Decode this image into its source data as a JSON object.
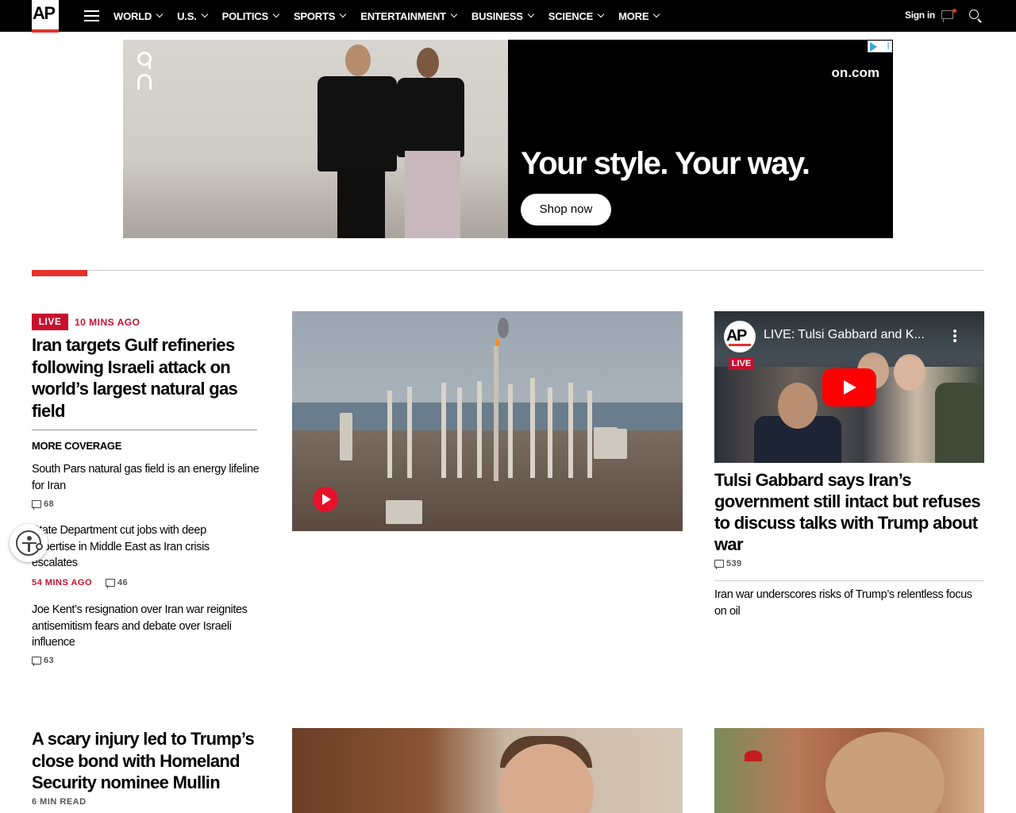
{
  "header": {
    "logo_text": "AP",
    "nav_items": [
      "WORLD",
      "U.S.",
      "POLITICS",
      "SPORTS",
      "ENTERTAINMENT",
      "BUSINESS",
      "SCIENCE",
      "MORE"
    ],
    "sign_in": "Sign in",
    "icons": [
      "menu-icon",
      "chevron-down-icon",
      "notification-icon",
      "search-icon"
    ]
  },
  "ad": {
    "domain": "on.com",
    "headline": "Your style. Your way.",
    "cta": "Shop now"
  },
  "lead": {
    "live_label": "LIVE",
    "time": "10 MINS AGO",
    "headline": "Iran targets Gulf refineries following Israeli attack on world’s largest natural gas field",
    "more_coverage": "MORE COVERAGE",
    "stories": [
      {
        "title": "South Pars natural gas field is an energy lifeline for Iran",
        "comments": "68"
      },
      {
        "title": "State Department cut jobs with deep expertise in Middle East as Iran crisis escalates",
        "time": "54 MINS AGO",
        "comments": "46"
      },
      {
        "title": "Joe Kent’s resignation over Iran war reignites antisemitism fears and debate over Israeli influence",
        "comments": "63"
      }
    ]
  },
  "video": {
    "logo_text": "AP",
    "live_label": "LIVE",
    "title": "LIVE: Tulsi Gabbard and K..."
  },
  "right": {
    "headline": "Tulsi Gabbard says Iran’s government still intact but refuses to discuss talks with Trump about war",
    "comments": "539",
    "sub_story": "Iran war underscores risks of Trump’s relentless focus on oil"
  },
  "bottom": {
    "headline": "A scary injury led to Trump’s close bond with Homeland Security nominee Mullin",
    "read_time": "6 MIN READ"
  },
  "colors": {
    "accent_red": "#e5322c",
    "live_red": "#c8102e",
    "nav_bg": "#000000"
  }
}
